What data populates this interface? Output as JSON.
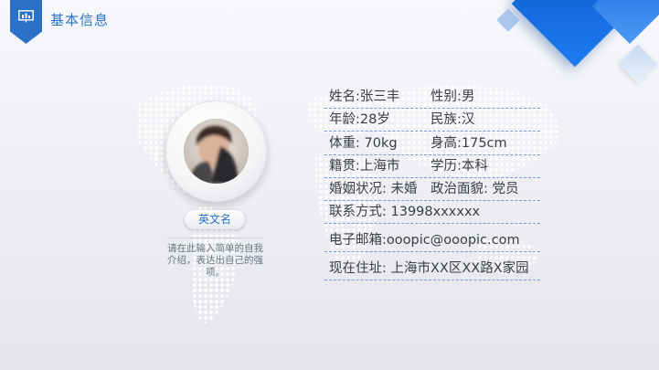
{
  "header": {
    "title": "基本信息"
  },
  "profile": {
    "english_name": "英文名",
    "intro": "请在此输入简单的自我介绍，表达出自己的强项。"
  },
  "info_rows": [
    {
      "left": "姓名:张三丰",
      "right": "性别:男"
    },
    {
      "left": "年龄:28岁",
      "right": "民族:汉"
    },
    {
      "left": "体重: 70kg",
      "right": "身高:175cm"
    },
    {
      "left": "籍贯:上海市",
      "right": "学历:本科"
    },
    {
      "left": "婚姻状况: 未婚",
      "right": "政治面貌: 党员"
    },
    {
      "left": "联系方式: 13998xxxxxx",
      "right": ""
    },
    {
      "left": "电子邮箱:ooopic@ooopic.com",
      "right": ""
    },
    {
      "left": "现在住址: 上海市XX区XX路X家园",
      "right": ""
    }
  ],
  "colors": {
    "accent": "#2a72c9",
    "cube_dark": "#0b56c9",
    "divider": "#6f9ed8"
  },
  "icons": {
    "header_badge": "presentation-chart-icon"
  }
}
